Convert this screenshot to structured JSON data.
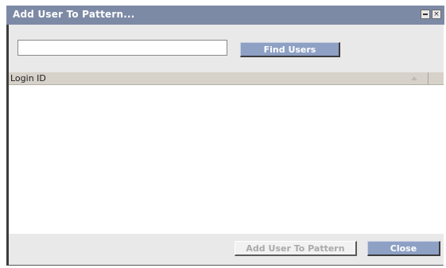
{
  "window": {
    "title": "Add User To Pattern...",
    "minimize_symbol": "",
    "close_symbol": "×"
  },
  "search": {
    "value": "",
    "placeholder": "",
    "find_label": "Find Users"
  },
  "table": {
    "columns": [
      {
        "label": "Login ID",
        "sort_icon": "sort-up-arrow-icon"
      }
    ],
    "rows": []
  },
  "footer": {
    "add_label": "Add User To Pattern",
    "add_enabled": false,
    "close_label": "Close"
  },
  "colors": {
    "titlebar": "#7d8aa6",
    "button": "#8ea0c4",
    "panel": "#e9e9e9",
    "header": "#d6d2ca"
  }
}
